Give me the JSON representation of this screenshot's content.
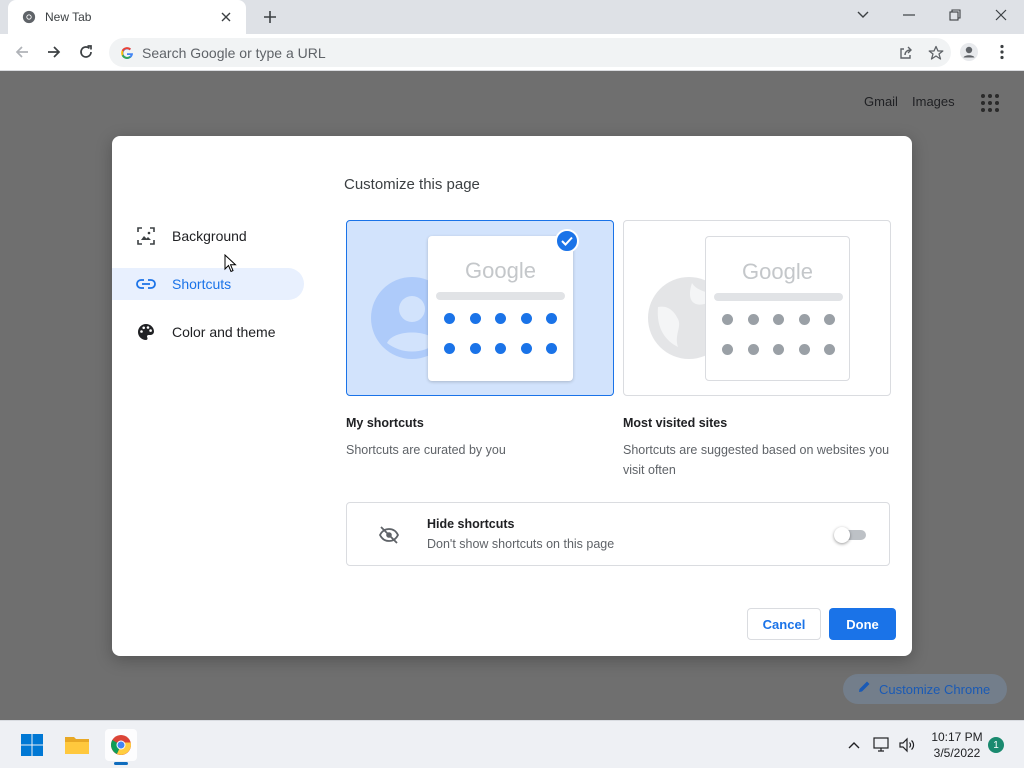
{
  "browser": {
    "tab_title": "New Tab",
    "omnibox_placeholder": "Search Google or type a URL"
  },
  "page": {
    "top_links": [
      "Gmail",
      "Images"
    ],
    "customize_chrome_label": "Customize Chrome"
  },
  "dialog": {
    "title": "Customize this page",
    "nav": [
      {
        "label": "Background",
        "icon": "image-icon",
        "active": false
      },
      {
        "label": "Shortcuts",
        "icon": "link-icon",
        "active": true
      },
      {
        "label": "Color and theme",
        "icon": "palette-icon",
        "active": false
      }
    ],
    "options": [
      {
        "title": "My shortcuts",
        "description": "Shortcuts are curated by you",
        "selected": true,
        "preview_logo": "Google"
      },
      {
        "title": "Most visited sites",
        "description": "Shortcuts are suggested based on websites you visit often",
        "selected": false,
        "preview_logo": "Google"
      }
    ],
    "hide_shortcuts": {
      "title": "Hide shortcuts",
      "description": "Don't show shortcuts on this page",
      "enabled": false
    },
    "cancel_label": "Cancel",
    "done_label": "Done"
  },
  "taskbar": {
    "time": "10:17 PM",
    "date": "3/5/2022",
    "notification_count": "1"
  },
  "colors": {
    "accent": "#1a73e8",
    "selected_bg": "#d2e3fc",
    "nav_active_bg": "#e8f0fe"
  }
}
